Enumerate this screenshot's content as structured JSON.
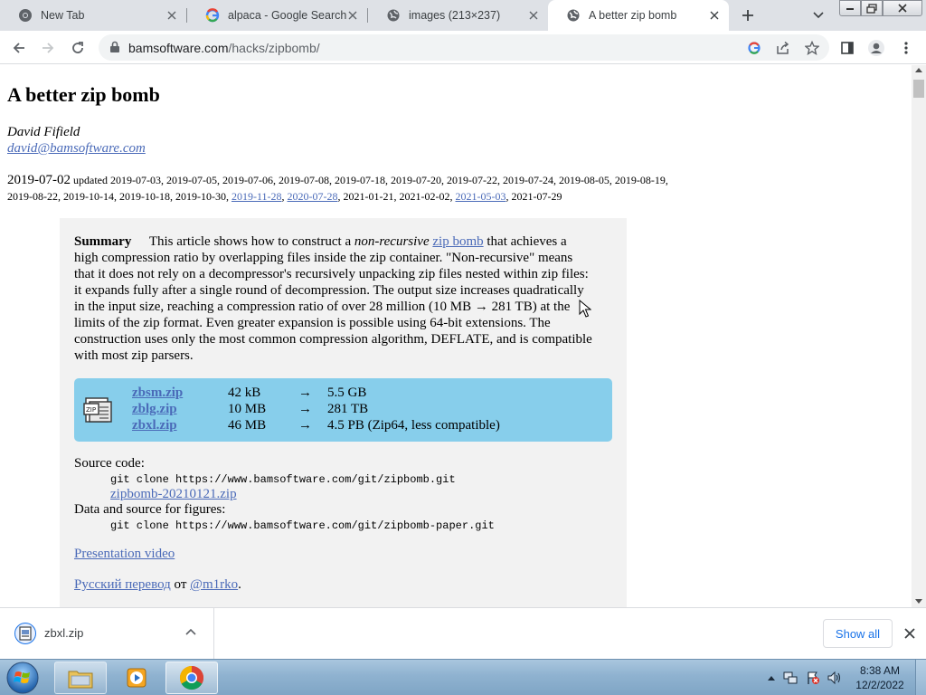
{
  "browser": {
    "tabs": [
      {
        "label": "New Tab",
        "icon": "chrome-icon"
      },
      {
        "label": "alpaca - Google Search",
        "icon": "google-icon"
      },
      {
        "label": "images (213×237)",
        "icon": "globe-icon"
      },
      {
        "label": "A better zip bomb",
        "icon": "globe-icon",
        "active": true
      }
    ],
    "url_host": "bamsoftware.com",
    "url_path": "/hacks/zipbomb/"
  },
  "page": {
    "title": "A better zip bomb",
    "author": "David Fifield",
    "email": "david@bamsoftware.com",
    "date": "2019-07-02",
    "updated_label": "updated",
    "updated_plain_1": "2019-07-03, 2019-07-05, 2019-07-06, 2019-07-08, 2019-07-18, 2019-07-20, 2019-07-22, 2019-07-24, 2019-08-05, 2019-08-19, 2019-08-22, 2019-10-14, 2019-10-18, 2019-10-30,",
    "updated_link_1": "2019-11-28",
    "updated_link_2": "2020-07-28",
    "updated_plain_2": "2021-01-21, 2021-02-02,",
    "updated_link_3": "2021-05-03",
    "updated_plain_3": "2021-07-29",
    "summary_label": "Summary",
    "summary_pre": "This article shows how to construct a",
    "summary_em": "non-recursive",
    "summary_link": "zip bomb",
    "summary_post": "that achieves a high compression ratio by overlapping files inside the zip container. \"Non-recursive\" means that it does not rely on a decompressor's recursively unpacking zip files nested within zip files: it expands fully after a single round of decompression. The output size increases quadratically in the input size, reaching a compression ratio of over 28 million (10 MB → 281 TB) at the limits of the zip format. Even greater expansion is possible using 64-bit extensions. The construction uses only the most common compression algorithm, DEFLATE, and is compatible with most zip parsers.",
    "downloads": [
      {
        "name": "zbsm.zip",
        "size": "42 kB",
        "arrow": "→",
        "output": "5.5 GB"
      },
      {
        "name": "zblg.zip",
        "size": "10 MB",
        "arrow": "→",
        "output": "281 TB"
      },
      {
        "name": "zbxl.zip",
        "size": "46 MB",
        "arrow": "→",
        "output": "4.5 PB (Zip64, less compatible)"
      }
    ],
    "source_code_label": "Source code:",
    "source_git": "git clone https://www.bamsoftware.com/git/zipbomb.git",
    "source_zip": "zipbomb-20210121.zip",
    "data_label": "Data and source for figures:",
    "data_git": "git clone https://www.bamsoftware.com/git/zipbomb-paper.git",
    "video_link": "Presentation video",
    "russian_link": "Русский перевод",
    "russian_by": "от",
    "russian_author": "@m1rko",
    "russian_end": "."
  },
  "download_shelf": {
    "file": "zbxl.zip",
    "show_all": "Show all"
  },
  "taskbar": {
    "time": "8:38 AM",
    "date": "12/2/2022"
  }
}
